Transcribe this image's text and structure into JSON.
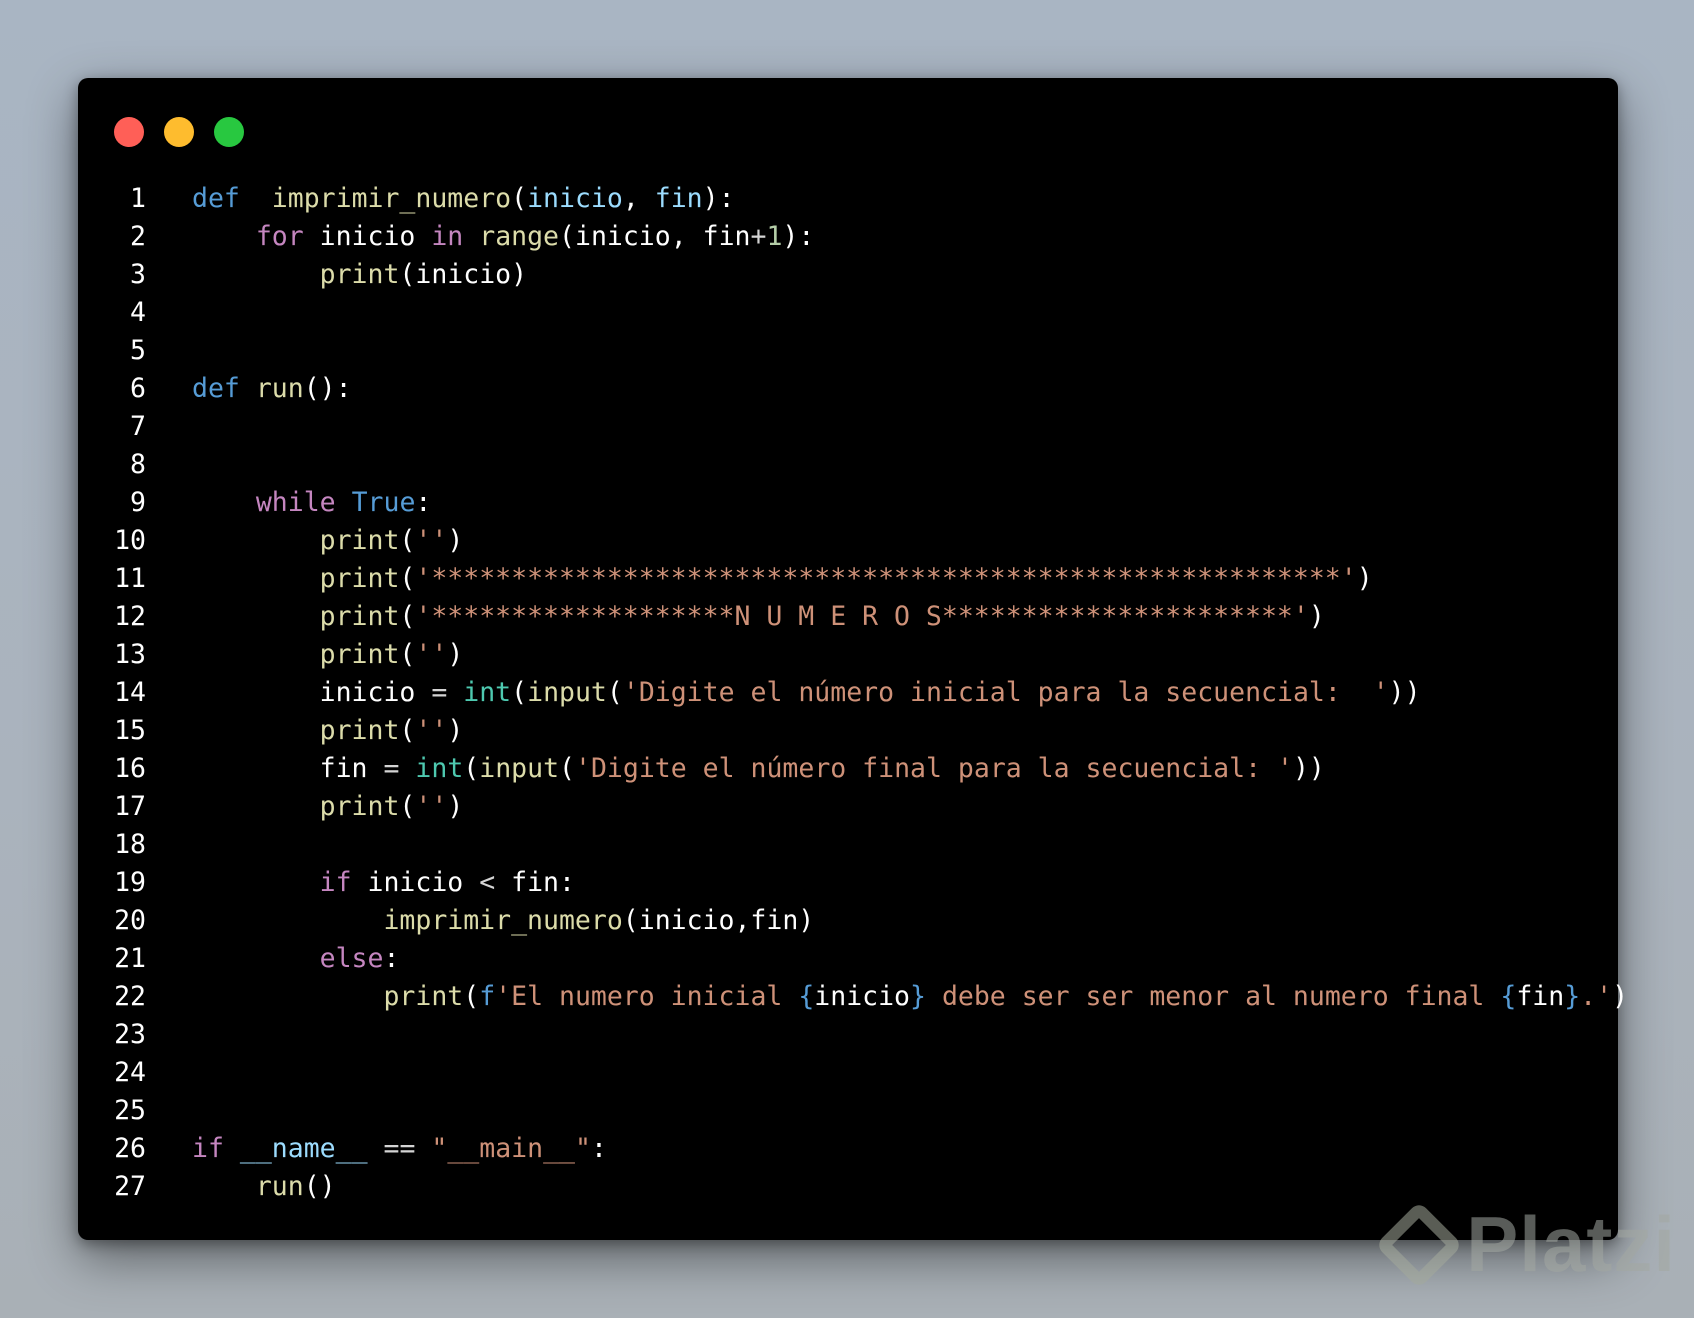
{
  "window": {
    "traffic_lights": [
      {
        "name": "close",
        "color": "#ff5f57"
      },
      {
        "name": "minimize",
        "color": "#febc2e"
      },
      {
        "name": "maximize",
        "color": "#28c840"
      }
    ]
  },
  "token_colors": {
    "kw-def": "#569cd6",
    "kw-ctl": "#c586c0",
    "fn": "#dcdcaa",
    "param": "#9cdcfe",
    "str": "#ce9178",
    "num": "#b5cea8",
    "type": "#4ec9b0",
    "var": "#ffffff"
  },
  "code": {
    "language": "python",
    "lines": [
      {
        "n": "1",
        "tokens": [
          [
            "kw-def",
            "def"
          ],
          [
            "",
            "  "
          ],
          [
            "fn",
            "imprimir_numero"
          ],
          [
            "punct",
            "("
          ],
          [
            "param",
            "inicio"
          ],
          [
            "punct",
            ", "
          ],
          [
            "param",
            "fin"
          ],
          [
            "punct",
            "):"
          ]
        ]
      },
      {
        "n": "2",
        "tokens": [
          [
            "",
            "    "
          ],
          [
            "kw-ctl",
            "for"
          ],
          [
            "var",
            " inicio "
          ],
          [
            "kw-ctl",
            "in"
          ],
          [
            "var",
            " "
          ],
          [
            "fn",
            "range"
          ],
          [
            "punct",
            "("
          ],
          [
            "var",
            "inicio, fin"
          ],
          [
            "op",
            "+"
          ],
          [
            "num",
            "1"
          ],
          [
            "punct",
            "):"
          ]
        ]
      },
      {
        "n": "3",
        "tokens": [
          [
            "",
            "        "
          ],
          [
            "fn",
            "print"
          ],
          [
            "punct",
            "("
          ],
          [
            "var",
            "inicio"
          ],
          [
            "punct",
            ")"
          ]
        ]
      },
      {
        "n": "4",
        "tokens": []
      },
      {
        "n": "5",
        "tokens": []
      },
      {
        "n": "6",
        "tokens": [
          [
            "kw-def",
            "def"
          ],
          [
            "var",
            " "
          ],
          [
            "fn",
            "run"
          ],
          [
            "punct",
            "():"
          ]
        ]
      },
      {
        "n": "7",
        "tokens": []
      },
      {
        "n": "8",
        "tokens": []
      },
      {
        "n": "9",
        "tokens": [
          [
            "",
            "    "
          ],
          [
            "kw-ctl",
            "while"
          ],
          [
            "var",
            " "
          ],
          [
            "const",
            "True"
          ],
          [
            "punct",
            ":"
          ]
        ]
      },
      {
        "n": "10",
        "tokens": [
          [
            "",
            "        "
          ],
          [
            "fn",
            "print"
          ],
          [
            "punct",
            "("
          ],
          [
            "str",
            "''"
          ],
          [
            "punct",
            ")"
          ]
        ]
      },
      {
        "n": "11",
        "tokens": [
          [
            "",
            "        "
          ],
          [
            "fn",
            "print"
          ],
          [
            "punct",
            "("
          ],
          [
            "str",
            "'*********************************************************'"
          ],
          [
            "punct",
            ")"
          ]
        ]
      },
      {
        "n": "12",
        "tokens": [
          [
            "",
            "        "
          ],
          [
            "fn",
            "print"
          ],
          [
            "punct",
            "("
          ],
          [
            "str",
            "'*******************N U M E R O S**********************'"
          ],
          [
            "punct",
            ")"
          ]
        ]
      },
      {
        "n": "13",
        "tokens": [
          [
            "",
            "        "
          ],
          [
            "fn",
            "print"
          ],
          [
            "punct",
            "("
          ],
          [
            "str",
            "''"
          ],
          [
            "punct",
            ")"
          ]
        ]
      },
      {
        "n": "14",
        "tokens": [
          [
            "",
            "        "
          ],
          [
            "var",
            "inicio "
          ],
          [
            "op",
            "="
          ],
          [
            "var",
            " "
          ],
          [
            "type",
            "int"
          ],
          [
            "punct",
            "("
          ],
          [
            "fn",
            "input"
          ],
          [
            "punct",
            "("
          ],
          [
            "str",
            "'Digite el número inicial para la secuencial:  '"
          ],
          [
            "punct",
            "))"
          ]
        ]
      },
      {
        "n": "15",
        "tokens": [
          [
            "",
            "        "
          ],
          [
            "fn",
            "print"
          ],
          [
            "punct",
            "("
          ],
          [
            "str",
            "''"
          ],
          [
            "punct",
            ")"
          ]
        ]
      },
      {
        "n": "16",
        "tokens": [
          [
            "",
            "        "
          ],
          [
            "var",
            "fin "
          ],
          [
            "op",
            "="
          ],
          [
            "var",
            " "
          ],
          [
            "type",
            "int"
          ],
          [
            "punct",
            "("
          ],
          [
            "fn",
            "input"
          ],
          [
            "punct",
            "("
          ],
          [
            "str",
            "'Digite el número final para la secuencial: '"
          ],
          [
            "punct",
            "))"
          ]
        ]
      },
      {
        "n": "17",
        "tokens": [
          [
            "",
            "        "
          ],
          [
            "fn",
            "print"
          ],
          [
            "punct",
            "("
          ],
          [
            "str",
            "''"
          ],
          [
            "punct",
            ")"
          ]
        ]
      },
      {
        "n": "18",
        "tokens": []
      },
      {
        "n": "19",
        "tokens": [
          [
            "",
            "        "
          ],
          [
            "kw-ctl",
            "if"
          ],
          [
            "var",
            " inicio "
          ],
          [
            "op",
            "<"
          ],
          [
            "var",
            " fin:"
          ]
        ]
      },
      {
        "n": "20",
        "tokens": [
          [
            "",
            "            "
          ],
          [
            "fn",
            "imprimir_numero"
          ],
          [
            "punct",
            "("
          ],
          [
            "var",
            "inicio,fin"
          ],
          [
            "punct",
            ")"
          ]
        ]
      },
      {
        "n": "21",
        "tokens": [
          [
            "",
            "        "
          ],
          [
            "kw-ctl",
            "else"
          ],
          [
            "punct",
            ":"
          ]
        ]
      },
      {
        "n": "22",
        "tokens": [
          [
            "",
            "            "
          ],
          [
            "fn",
            "print"
          ],
          [
            "punct",
            "("
          ],
          [
            "kw-def",
            "f"
          ],
          [
            "str",
            "'El numero inicial "
          ],
          [
            "brace",
            "{"
          ],
          [
            "var",
            "inicio"
          ],
          [
            "brace",
            "}"
          ],
          [
            "str",
            " debe ser ser menor al numero final "
          ],
          [
            "brace",
            "{"
          ],
          [
            "var",
            "fin"
          ],
          [
            "brace",
            "}"
          ],
          [
            "str",
            ".'"
          ],
          [
            "punct",
            ")"
          ]
        ]
      },
      {
        "n": "23",
        "tokens": []
      },
      {
        "n": "24",
        "tokens": []
      },
      {
        "n": "25",
        "tokens": []
      },
      {
        "n": "26",
        "tokens": [
          [
            "kw-ctl",
            "if"
          ],
          [
            "var",
            " "
          ],
          [
            "param",
            "__name__"
          ],
          [
            "var",
            " "
          ],
          [
            "op",
            "=="
          ],
          [
            "var",
            " "
          ],
          [
            "str",
            "\"__main__\""
          ],
          [
            "punct",
            ":"
          ]
        ]
      },
      {
        "n": "27",
        "tokens": [
          [
            "",
            "    "
          ],
          [
            "fn",
            "run"
          ],
          [
            "punct",
            "()"
          ]
        ]
      }
    ]
  },
  "watermark": {
    "text": "Platzi",
    "icon": "platzi-logo-icon"
  }
}
